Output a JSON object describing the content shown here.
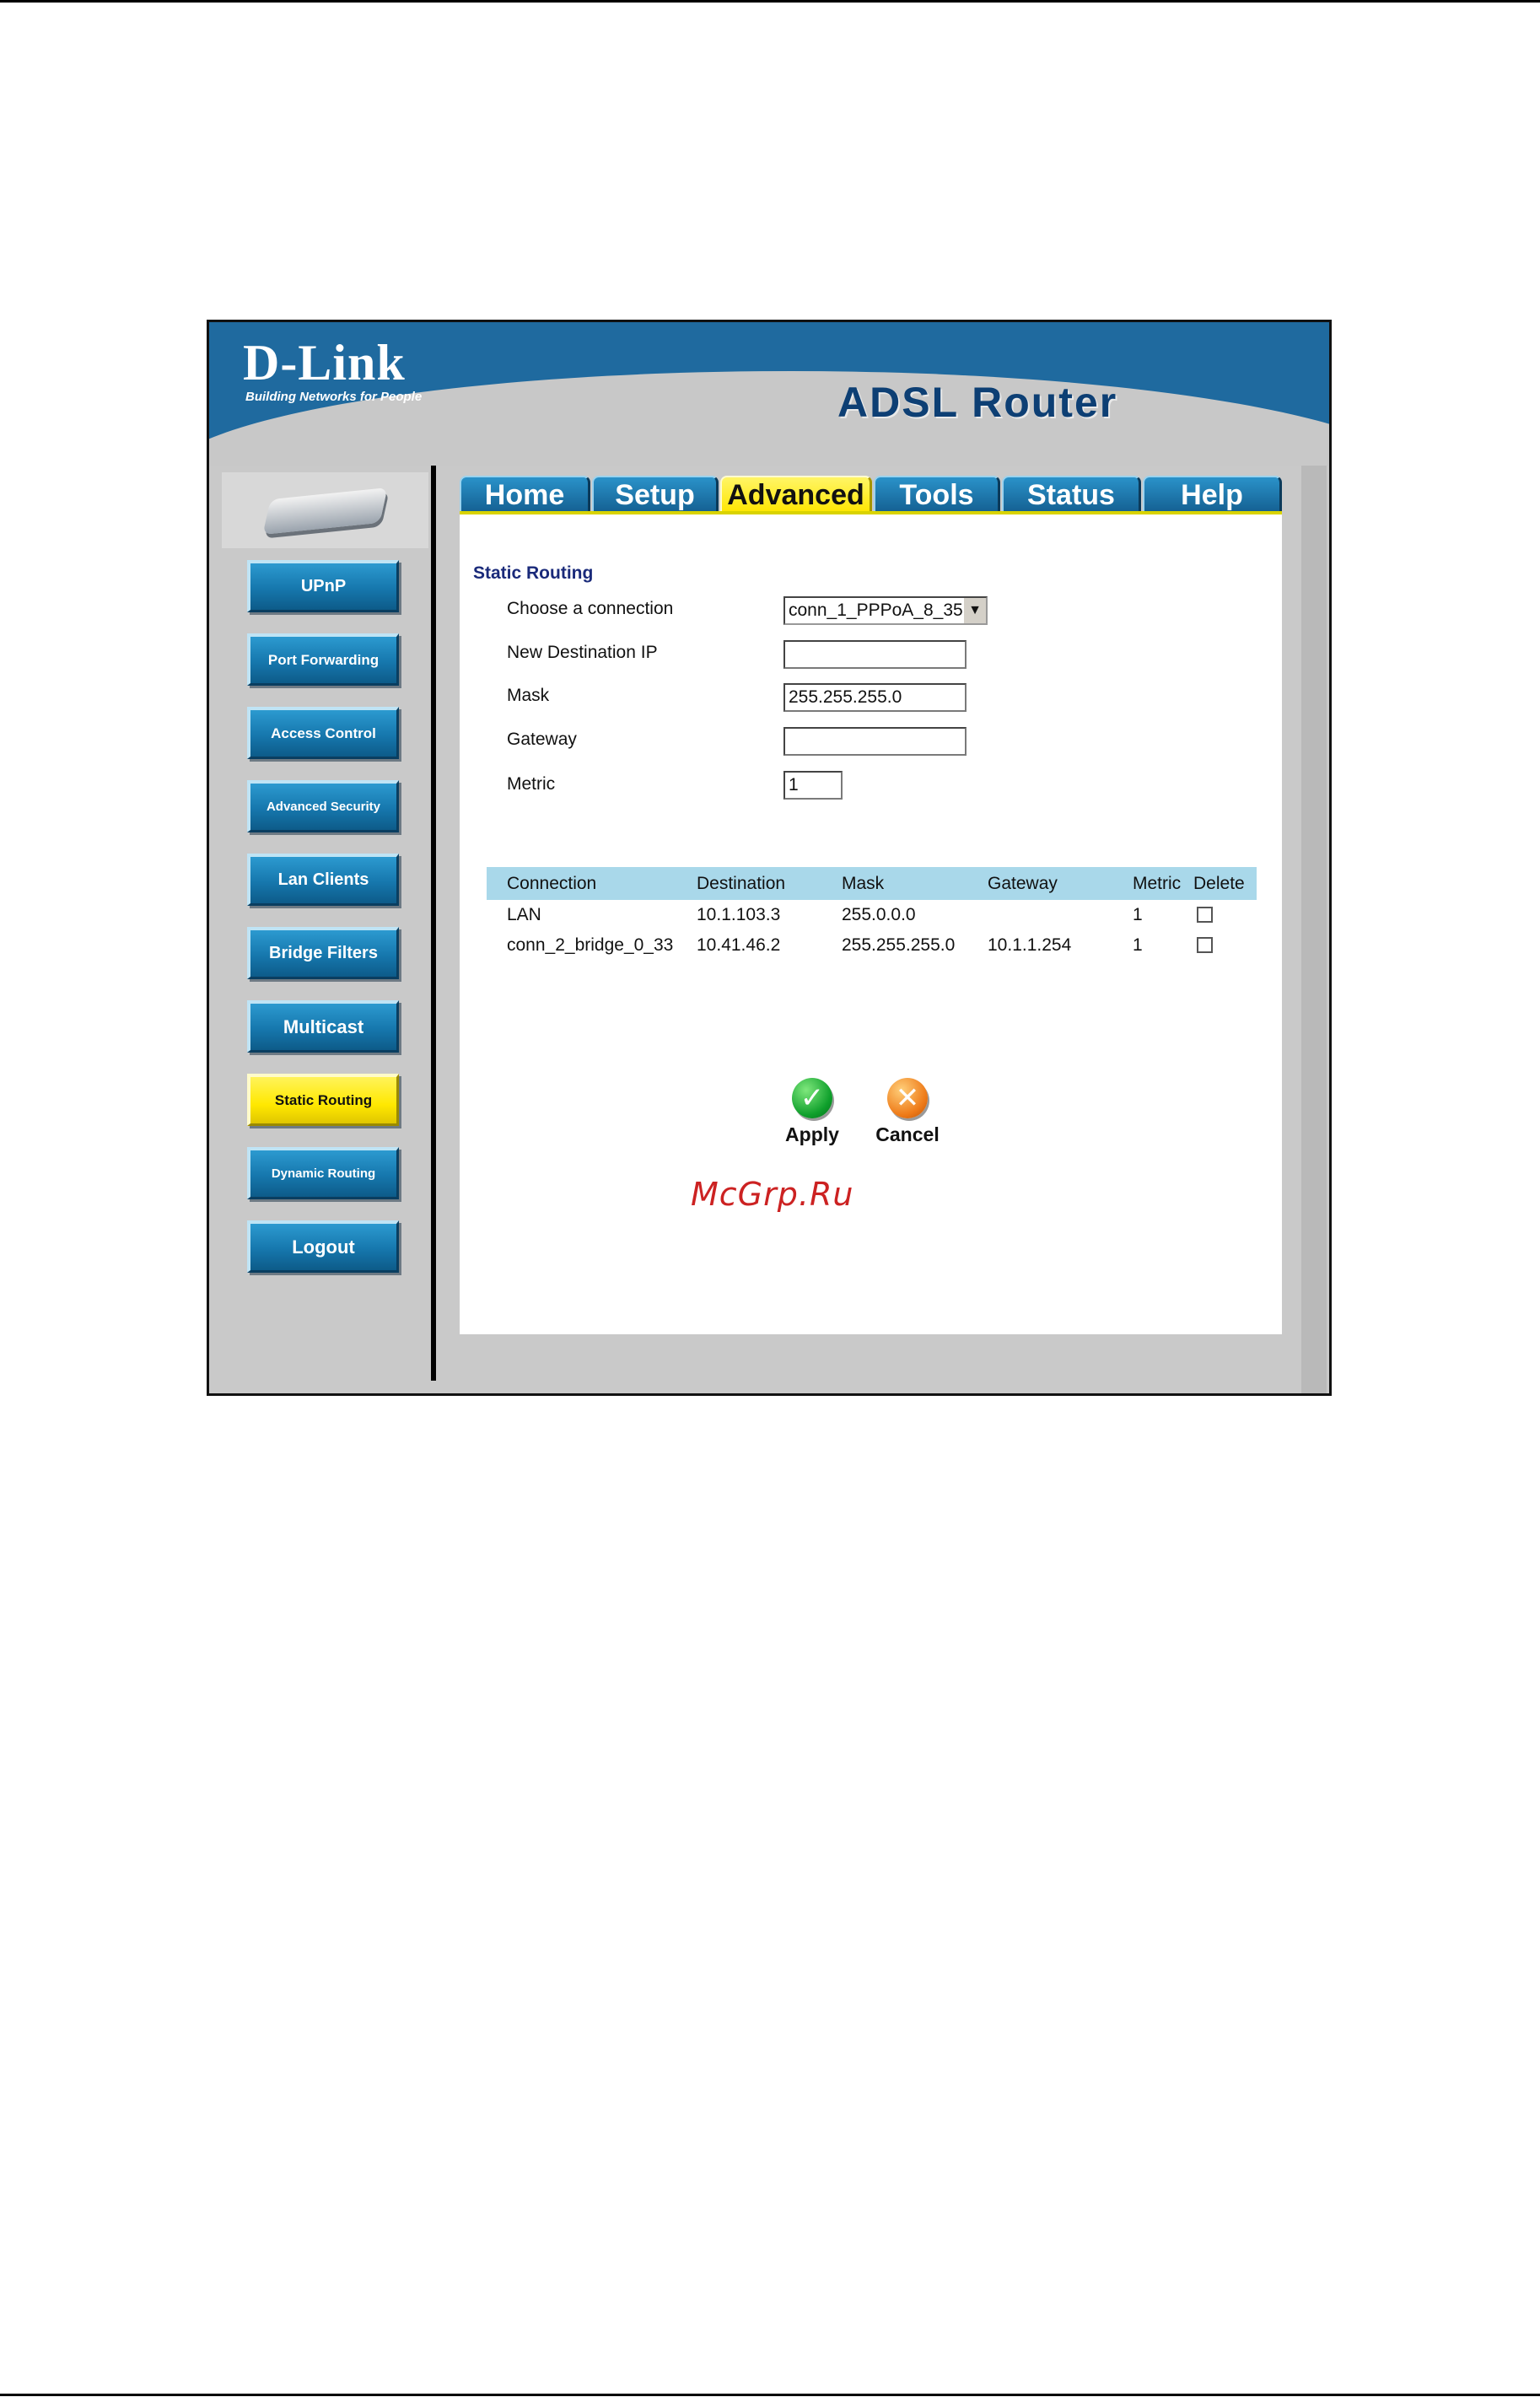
{
  "brand": {
    "logo": "D-Link",
    "tagline": "Building Networks for People",
    "product": "ADSL Router"
  },
  "tabs": [
    {
      "label": "Home"
    },
    {
      "label": "Setup"
    },
    {
      "label": "Advanced",
      "active": true
    },
    {
      "label": "Tools"
    },
    {
      "label": "Status"
    },
    {
      "label": "Help"
    }
  ],
  "sidebar": {
    "items": [
      {
        "label": "UPnP"
      },
      {
        "label": "Port Forwarding"
      },
      {
        "label": "Access Control"
      },
      {
        "label": "Advanced Security"
      },
      {
        "label": "Lan Clients"
      },
      {
        "label": "Bridge Filters"
      },
      {
        "label": "Multicast"
      },
      {
        "label": "Static Routing",
        "active": true
      },
      {
        "label": "Dynamic Routing"
      },
      {
        "label": "Logout"
      }
    ]
  },
  "form": {
    "title": "Static Routing",
    "connection_label": "Choose a connection",
    "connection_value": "conn_1_PPPoA_8_35",
    "dest_label": "New Destination IP",
    "dest_value": "",
    "mask_label": "Mask",
    "mask_value": "255.255.255.0",
    "gateway_label": "Gateway",
    "gateway_value": "",
    "metric_label": "Metric",
    "metric_value": "1"
  },
  "table": {
    "headers": [
      "Connection",
      "Destination",
      "Mask",
      "Gateway",
      "Metric",
      "Delete"
    ],
    "rows": [
      {
        "connection": "LAN",
        "destination": "10.1.103.3",
        "mask": "255.0.0.0",
        "gateway": "",
        "metric": "1",
        "delete": false
      },
      {
        "connection": "conn_2_bridge_0_33",
        "destination": "10.41.46.2",
        "mask": "255.255.255.0",
        "gateway": "10.1.1.254",
        "metric": "1",
        "delete": false
      }
    ]
  },
  "actions": {
    "apply": "Apply",
    "cancel": "Cancel"
  },
  "watermark": "McGrp.Ru",
  "colors": {
    "accent_blue": "#1f6a9f",
    "active_yellow": "#ffe800",
    "table_header": "#a9d8ea"
  }
}
